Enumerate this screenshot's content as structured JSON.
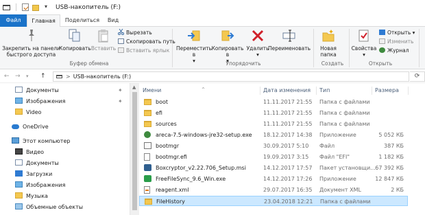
{
  "window": {
    "title": "USB-накопитель (F:)"
  },
  "ribbon_tabs": [
    "Файл",
    "Главная",
    "Поделиться",
    "Вид"
  ],
  "ribbon": {
    "clipboard": {
      "pin": "Закрепить на панели быстрого доступа",
      "copy": "Копировать",
      "paste": "Вставить",
      "cut": "Вырезать",
      "copy_path": "Скопировать путь",
      "paste_shortcut": "Вставить ярлык",
      "group": "Буфер обмена"
    },
    "organize": {
      "move": "Переместить в",
      "copy_to": "Копировать в",
      "delete": "Удалить",
      "rename": "Переименовать",
      "group": "Упорядочить"
    },
    "create": {
      "new_folder": "Новая папка",
      "group": "Создать"
    },
    "open": {
      "properties": "Свойства",
      "open": "Открыть",
      "edit": "Изменить",
      "history": "Журнал",
      "group": "Открыть"
    }
  },
  "address": {
    "path": "USB-накопитель (F:)",
    "separator": ">"
  },
  "nav": [
    {
      "label": "Документы",
      "icon": "documents-icon",
      "pinned": true
    },
    {
      "label": "Изображения",
      "icon": "pictures-icon",
      "pinned": true
    },
    {
      "label": "Video",
      "icon": "folder-icon",
      "pinned": false
    },
    {
      "label": "OneDrive",
      "icon": "onedrive-icon",
      "pinned": false
    },
    {
      "label": "Этот компьютер",
      "icon": "computer-icon",
      "pinned": false
    },
    {
      "label": "Видео",
      "icon": "videos-icon",
      "pinned": false
    },
    {
      "label": "Документы",
      "icon": "documents-icon",
      "pinned": false
    },
    {
      "label": "Загрузки",
      "icon": "downloads-icon",
      "pinned": false
    },
    {
      "label": "Изображения",
      "icon": "pictures-icon",
      "pinned": false
    },
    {
      "label": "Музыка",
      "icon": "music-icon",
      "pinned": false
    },
    {
      "label": "Объемные объекты",
      "icon": "3d-objects-icon",
      "pinned": false
    }
  ],
  "columns": {
    "name": "Имени",
    "date": "Дата изменения",
    "type": "Тип",
    "size": "Размера"
  },
  "files": [
    {
      "name": "boot",
      "date": "11.11.2017 21:55",
      "type": "Папка с файлами",
      "size": "",
      "icon": "folder"
    },
    {
      "name": "efi",
      "date": "11.11.2017 21:55",
      "type": "Папка с файлами",
      "size": "",
      "icon": "folder"
    },
    {
      "name": "sources",
      "date": "11.11.2017 21:55",
      "type": "Папка с файлами",
      "size": "",
      "icon": "folder"
    },
    {
      "name": "areca-7.5-windows-jre32-setup.exe",
      "date": "18.12.2017 14:38",
      "type": "Приложение",
      "size": "5 052 КБ",
      "icon": "exe"
    },
    {
      "name": "bootmgr",
      "date": "30.09.2017 5:10",
      "type": "Файл",
      "size": "387 КБ",
      "icon": "app"
    },
    {
      "name": "bootmgr.efi",
      "date": "19.09.2017 3:15",
      "type": "Файл \"EFI\"",
      "size": "1 182 КБ",
      "icon": "efi"
    },
    {
      "name": "Boxcryptor_v2.22.706_Setup.msi",
      "date": "14.12.2017 17:57",
      "type": "Пакет установщи...",
      "size": "67 392 КБ",
      "icon": "box"
    },
    {
      "name": "FreeFileSync_9.6_Win.exe",
      "date": "14.12.2017 17:26",
      "type": "Приложение",
      "size": "12 847 КБ",
      "icon": "ffs"
    },
    {
      "name": "reagent.xml",
      "date": "29.07.2017 16:35",
      "type": "Документ XML",
      "size": "2 КБ",
      "icon": "xml"
    },
    {
      "name": "FileHistory",
      "date": "23.04.2018 12:21",
      "type": "Папка с файлами",
      "size": "",
      "icon": "folder",
      "selected": true
    }
  ]
}
